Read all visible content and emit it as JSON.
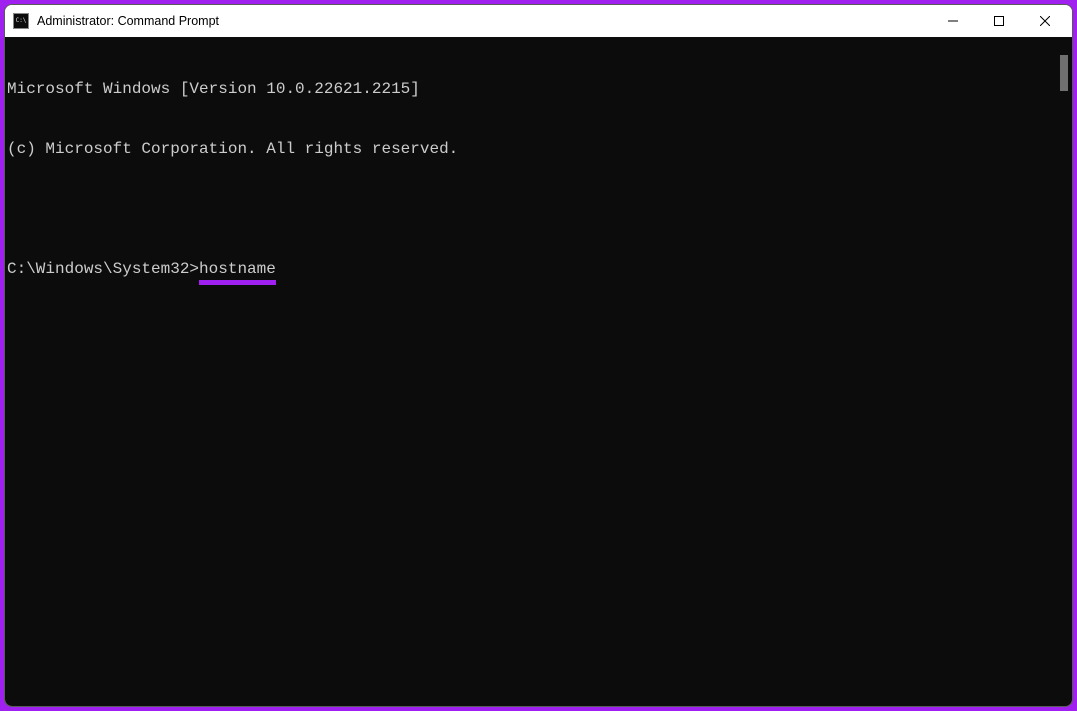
{
  "window": {
    "title": "Administrator: Command Prompt"
  },
  "terminal": {
    "line1": "Microsoft Windows [Version 10.0.22621.2215]",
    "line2": "(c) Microsoft Corporation. All rights reserved.",
    "prompt": "C:\\Windows\\System32>",
    "command": "hostname"
  },
  "colors": {
    "accent": "#a020f0",
    "terminal_bg": "#0c0c0c",
    "terminal_fg": "#cccccc"
  }
}
